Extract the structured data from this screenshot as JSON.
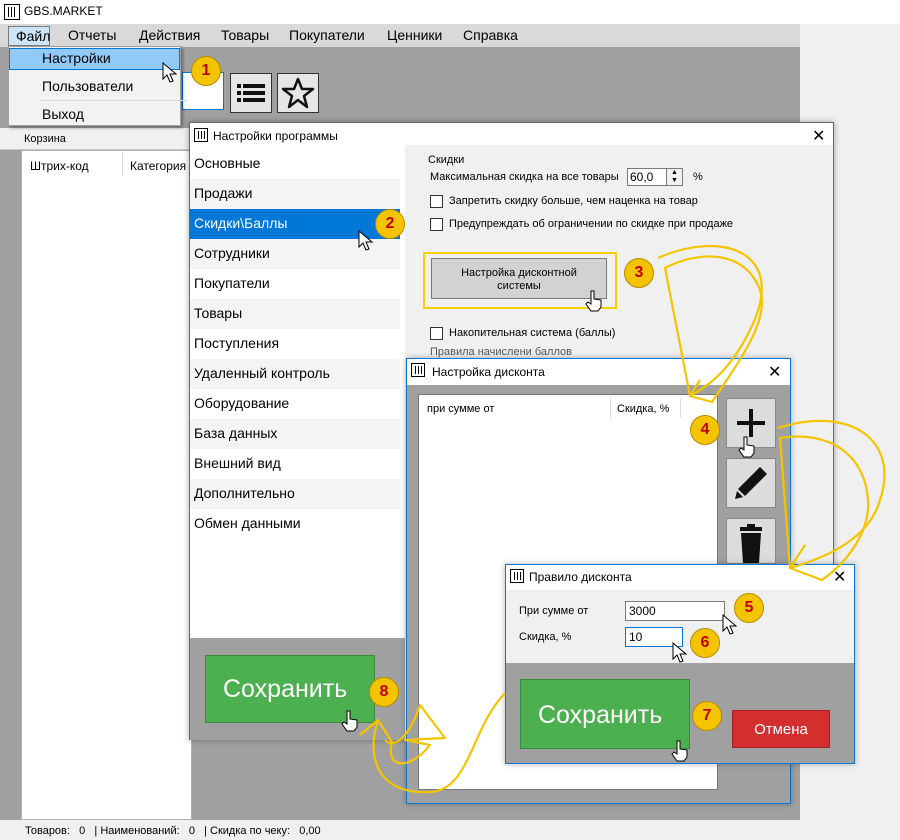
{
  "window": {
    "title": "GBS.MARKET",
    "menu": [
      "Файл",
      "Отчеты",
      "Действия",
      "Товары",
      "Покупатели",
      "Ценники",
      "Справка"
    ]
  },
  "file_menu": {
    "items": [
      "Настройки",
      "Пользователи",
      "Выход"
    ]
  },
  "cart": {
    "label": "Корзина",
    "columns": [
      "Штрих-код",
      "Категория"
    ]
  },
  "status_bar": {
    "text": "Товаров:   0   | Наименований:   0   | Скидка по чеку:   0,00"
  },
  "settings_window": {
    "title": "Настройки программы",
    "sidebar": [
      "Основные",
      "Продажи",
      "Скидки\\Баллы",
      "Сотрудники",
      "Покупатели",
      "Товары",
      "Поступления",
      "Удаленный контроль",
      "Оборудование",
      "База данных",
      "Внешний вид",
      "Дополнительно",
      "Обмен данными"
    ],
    "selected_index": 2,
    "discounts": {
      "legend": "Скидки",
      "max_discount_label": "Максимальная скидка на все товары",
      "max_discount_value": "60,0",
      "percent": "%",
      "checkbox_forbid": "Запретить скидку больше, чем наценка на товар",
      "checkbox_warn": "Предупреждать об ограничении по скидке при продаже",
      "setup_button_line1": "Настройка дисконтной",
      "setup_button_line2": "системы"
    },
    "accumulative": {
      "checkbox": "Накопительная система (баллы)",
      "rules_label": "Правила начислени баллов"
    },
    "save_label": "Сохранить"
  },
  "discount_window": {
    "title": "Настройка дисконта",
    "columns": [
      "при сумме от",
      "Скидка, %"
    ]
  },
  "rule_window": {
    "title": "Правило дисконта",
    "sum_label": "При сумме от",
    "sum_value": "3000",
    "discount_label": "Скидка, %",
    "discount_value": "10",
    "save_label": "Сохранить",
    "cancel_label": "Отмена"
  },
  "steps": [
    "1",
    "2",
    "3",
    "4",
    "5",
    "6",
    "7",
    "8"
  ],
  "colors": {
    "badge": "#f5c400",
    "badge_text": "#c00000",
    "arrow": "#f5c400",
    "save_green": "#4caf50",
    "cancel_red": "#d32f2f",
    "selection_blue": "#0078d7"
  }
}
